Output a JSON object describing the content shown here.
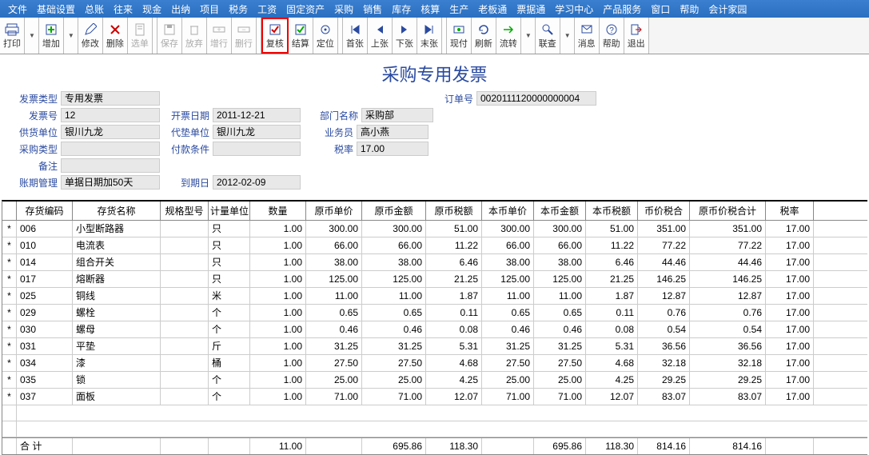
{
  "menu": [
    "文件",
    "基础设置",
    "总账",
    "往来",
    "现金",
    "出纳",
    "项目",
    "税务",
    "工资",
    "固定资产",
    "采购",
    "销售",
    "库存",
    "核算",
    "生产",
    "老板通",
    "票据通",
    "学习中心",
    "产品服务",
    "窗口",
    "帮助",
    "会计家园"
  ],
  "toolbar": [
    {
      "label": "打印",
      "icon": "printer"
    },
    {
      "label": "增加",
      "icon": "plus"
    },
    {
      "label": "修改",
      "icon": "pencil"
    },
    {
      "label": "删除",
      "icon": "cross"
    },
    {
      "label": "选单",
      "icon": "sheet"
    },
    {
      "label": "保存",
      "icon": "disk"
    },
    {
      "label": "放弃",
      "icon": "trash"
    },
    {
      "label": "增行",
      "icon": "addrow"
    },
    {
      "label": "删行",
      "icon": "delrow"
    },
    {
      "label": "复核",
      "icon": "check"
    },
    {
      "label": "结算",
      "icon": "settle"
    },
    {
      "label": "定位",
      "icon": "locate"
    },
    {
      "label": "首张",
      "icon": "first"
    },
    {
      "label": "上张",
      "icon": "prev"
    },
    {
      "label": "下张",
      "icon": "next"
    },
    {
      "label": "末张",
      "icon": "last"
    },
    {
      "label": "现付",
      "icon": "pay"
    },
    {
      "label": "刷新",
      "icon": "refresh"
    },
    {
      "label": "流转",
      "icon": "flow"
    },
    {
      "label": "联查",
      "icon": "link"
    },
    {
      "label": "消息",
      "icon": "msg"
    },
    {
      "label": "帮助",
      "icon": "help"
    },
    {
      "label": "退出",
      "icon": "exit"
    }
  ],
  "highlighted_tool_index": 9,
  "title": "采购专用发票",
  "form": {
    "发票类型": "专用发票",
    "订单号": "0020111120000000004",
    "发票号": "12",
    "开票日期": "2011-12-21",
    "部门名称": "采购部",
    "供货单位": "银川九龙",
    "代垫单位": "银川九龙",
    "业务员": "高小燕",
    "采购类型": "",
    "付款条件": "",
    "税率": "17.00",
    "备注": "",
    "账期管理": "单据日期加50天",
    "到期日": "2012-02-09"
  },
  "columns": [
    "",
    "存货编码",
    "存货名称",
    "规格型号",
    "计量单位",
    "数量",
    "原币单价",
    "原币金额",
    "原币税额",
    "本币单价",
    "本币金额",
    "本币税额",
    "币价税合",
    "原币价税合计",
    "税率"
  ],
  "rows": [
    {
      "mark": "*",
      "code": "006",
      "name": "小型断路器",
      "spec": "",
      "unit": "只",
      "qty": "1.00",
      "oprice": "300.00",
      "oamt": "300.00",
      "otax": "51.00",
      "bprice": "300.00",
      "bamt": "300.00",
      "btax": "51.00",
      "ptax": "351.00",
      "ototal": "351.00",
      "rate": "17.00"
    },
    {
      "mark": "*",
      "code": "010",
      "name": "电流表",
      "spec": "",
      "unit": "只",
      "qty": "1.00",
      "oprice": "66.00",
      "oamt": "66.00",
      "otax": "11.22",
      "bprice": "66.00",
      "bamt": "66.00",
      "btax": "11.22",
      "ptax": "77.22",
      "ototal": "77.22",
      "rate": "17.00"
    },
    {
      "mark": "*",
      "code": "014",
      "name": "组合开关",
      "spec": "",
      "unit": "只",
      "qty": "1.00",
      "oprice": "38.00",
      "oamt": "38.00",
      "otax": "6.46",
      "bprice": "38.00",
      "bamt": "38.00",
      "btax": "6.46",
      "ptax": "44.46",
      "ototal": "44.46",
      "rate": "17.00"
    },
    {
      "mark": "*",
      "code": "017",
      "name": "熔断器",
      "spec": "",
      "unit": "只",
      "qty": "1.00",
      "oprice": "125.00",
      "oamt": "125.00",
      "otax": "21.25",
      "bprice": "125.00",
      "bamt": "125.00",
      "btax": "21.25",
      "ptax": "146.25",
      "ototal": "146.25",
      "rate": "17.00"
    },
    {
      "mark": "*",
      "code": "025",
      "name": "铜线",
      "spec": "",
      "unit": "米",
      "qty": "1.00",
      "oprice": "11.00",
      "oamt": "11.00",
      "otax": "1.87",
      "bprice": "11.00",
      "bamt": "11.00",
      "btax": "1.87",
      "ptax": "12.87",
      "ototal": "12.87",
      "rate": "17.00"
    },
    {
      "mark": "*",
      "code": "029",
      "name": "螺栓",
      "spec": "",
      "unit": "个",
      "qty": "1.00",
      "oprice": "0.65",
      "oamt": "0.65",
      "otax": "0.11",
      "bprice": "0.65",
      "bamt": "0.65",
      "btax": "0.11",
      "ptax": "0.76",
      "ototal": "0.76",
      "rate": "17.00"
    },
    {
      "mark": "*",
      "code": "030",
      "name": "螺母",
      "spec": "",
      "unit": "个",
      "qty": "1.00",
      "oprice": "0.46",
      "oamt": "0.46",
      "otax": "0.08",
      "bprice": "0.46",
      "bamt": "0.46",
      "btax": "0.08",
      "ptax": "0.54",
      "ototal": "0.54",
      "rate": "17.00"
    },
    {
      "mark": "*",
      "code": "031",
      "name": "平垫",
      "spec": "",
      "unit": "斤",
      "qty": "1.00",
      "oprice": "31.25",
      "oamt": "31.25",
      "otax": "5.31",
      "bprice": "31.25",
      "bamt": "31.25",
      "btax": "5.31",
      "ptax": "36.56",
      "ototal": "36.56",
      "rate": "17.00"
    },
    {
      "mark": "*",
      "code": "034",
      "name": "漆",
      "spec": "",
      "unit": "桶",
      "qty": "1.00",
      "oprice": "27.50",
      "oamt": "27.50",
      "otax": "4.68",
      "bprice": "27.50",
      "bamt": "27.50",
      "btax": "4.68",
      "ptax": "32.18",
      "ototal": "32.18",
      "rate": "17.00"
    },
    {
      "mark": "*",
      "code": "035",
      "name": "锁",
      "spec": "",
      "unit": "个",
      "qty": "1.00",
      "oprice": "25.00",
      "oamt": "25.00",
      "otax": "4.25",
      "bprice": "25.00",
      "bamt": "25.00",
      "btax": "4.25",
      "ptax": "29.25",
      "ototal": "29.25",
      "rate": "17.00"
    },
    {
      "mark": "*",
      "code": "037",
      "name": "面板",
      "spec": "",
      "unit": "个",
      "qty": "1.00",
      "oprice": "71.00",
      "oamt": "71.00",
      "otax": "12.07",
      "bprice": "71.00",
      "bamt": "71.00",
      "btax": "12.07",
      "ptax": "83.07",
      "ototal": "83.07",
      "rate": "17.00"
    }
  ],
  "totals": {
    "label": "合 计",
    "qty": "11.00",
    "oamt": "695.86",
    "otax": "118.30",
    "bamt": "695.86",
    "btax": "118.30",
    "ptax": "814.16",
    "ototal": "814.16"
  }
}
